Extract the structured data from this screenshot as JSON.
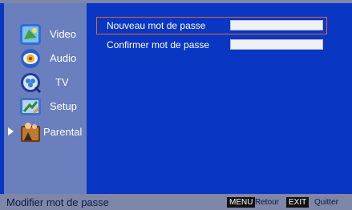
{
  "sidebar": {
    "items": [
      {
        "label": "Video",
        "icon": "video-icon",
        "selected": false
      },
      {
        "label": "Audio",
        "icon": "audio-icon",
        "selected": false
      },
      {
        "label": "TV",
        "icon": "tv-icon",
        "selected": false
      },
      {
        "label": "Setup",
        "icon": "setup-icon",
        "selected": false
      },
      {
        "label": "Parental",
        "icon": "parental-icon",
        "selected": true
      }
    ]
  },
  "main": {
    "fields": [
      {
        "label": "Nouveau mot de passe",
        "value": "",
        "selected": true
      },
      {
        "label": "Confirmer mot de passe",
        "value": "",
        "selected": false
      }
    ]
  },
  "status_bar": {
    "title": "Modifier mot de passe",
    "keys": [
      {
        "key": "MENU",
        "action": "Retour"
      },
      {
        "key": "EXIT",
        "action": "Quitter"
      }
    ]
  },
  "colors": {
    "background": "#0a36c4",
    "sidebar": "#6a7fbe",
    "status_bar": "#7e87a8",
    "highlight": "#e0682e"
  }
}
